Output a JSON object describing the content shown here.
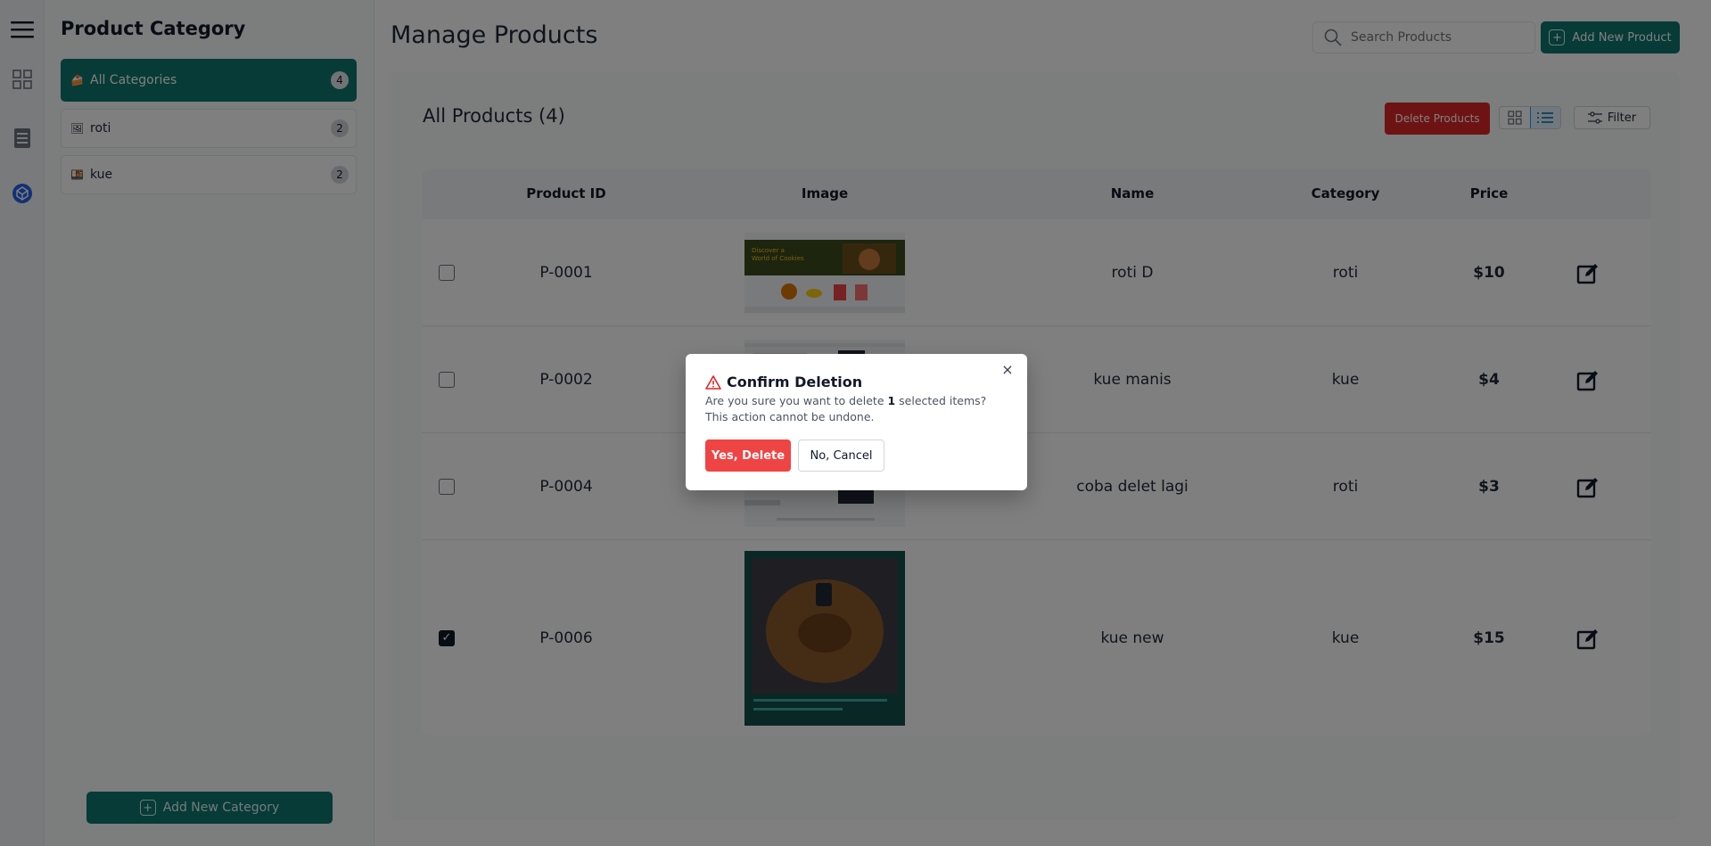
{
  "sidebar_icons": [
    "menu-icon",
    "dashboard-icon",
    "document-icon",
    "cube-icon"
  ],
  "categories": {
    "title": "Product Category",
    "items": [
      {
        "emoji": "🍰",
        "label": "All Categories",
        "count": "4"
      },
      {
        "emoji": "🖼",
        "label": "roti",
        "count": "2"
      },
      {
        "emoji": "🍱",
        "label": "kue",
        "count": "2"
      }
    ],
    "add_label": "Add New Category"
  },
  "header": {
    "title": "Manage Products",
    "search_placeholder": "Search Products",
    "add_label": "Add New Product"
  },
  "products": {
    "title": "All Products (4)",
    "delete_label": "Delete Products",
    "filter_label": "Filter",
    "columns": [
      "Product ID",
      "Image",
      "Name",
      "Category",
      "Price"
    ],
    "rows": [
      {
        "id": "P-0001",
        "name": "roti D",
        "category": "roti",
        "price": "$10",
        "checked": false
      },
      {
        "id": "P-0002",
        "name": "kue manis",
        "category": "kue",
        "price": "$4",
        "checked": false
      },
      {
        "id": "P-0004",
        "name": "coba delet lagi",
        "category": "roti",
        "price": "$3",
        "checked": false
      },
      {
        "id": "P-0006",
        "name": "kue new",
        "category": "kue",
        "price": "$15",
        "checked": true
      }
    ],
    "thumb1": {
      "line1": "Discover a",
      "line2": "World of Cookies"
    }
  },
  "modal": {
    "title": "Confirm Deletion",
    "text_before": "Are you sure you want to delete ",
    "count": "1",
    "text_after": " selected items? This action cannot be undone.",
    "yes_label": "Yes, Delete",
    "no_label": "No, Cancel",
    "close": "×"
  },
  "colors": {
    "primary": "#0f766e",
    "danger": "#dc2626",
    "danger_light": "#ef4444"
  }
}
